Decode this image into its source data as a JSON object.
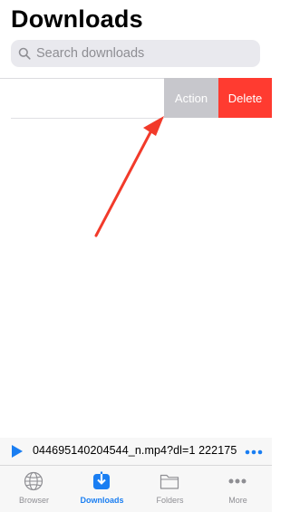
{
  "header": {
    "title": "Downloads"
  },
  "search": {
    "placeholder": "Search downloads",
    "icon": "search-icon"
  },
  "swipe_actions": {
    "action_label": "Action",
    "delete_label": "Delete"
  },
  "player": {
    "track_text": "044695140204544_n.mp4?dl=1 222175"
  },
  "tabbar": {
    "tabs": [
      {
        "label": "Browser",
        "icon": "globe-icon"
      },
      {
        "label": "Downloads",
        "icon": "download-icon",
        "active": true
      },
      {
        "label": "Folders",
        "icon": "folder-icon"
      },
      {
        "label": "More",
        "icon": "more-icon"
      }
    ]
  },
  "colors": {
    "accent": "#1a7ef2",
    "delete": "#ff3b30",
    "action": "#c7c7cc",
    "annotation_arrow": "#f23a2a"
  }
}
